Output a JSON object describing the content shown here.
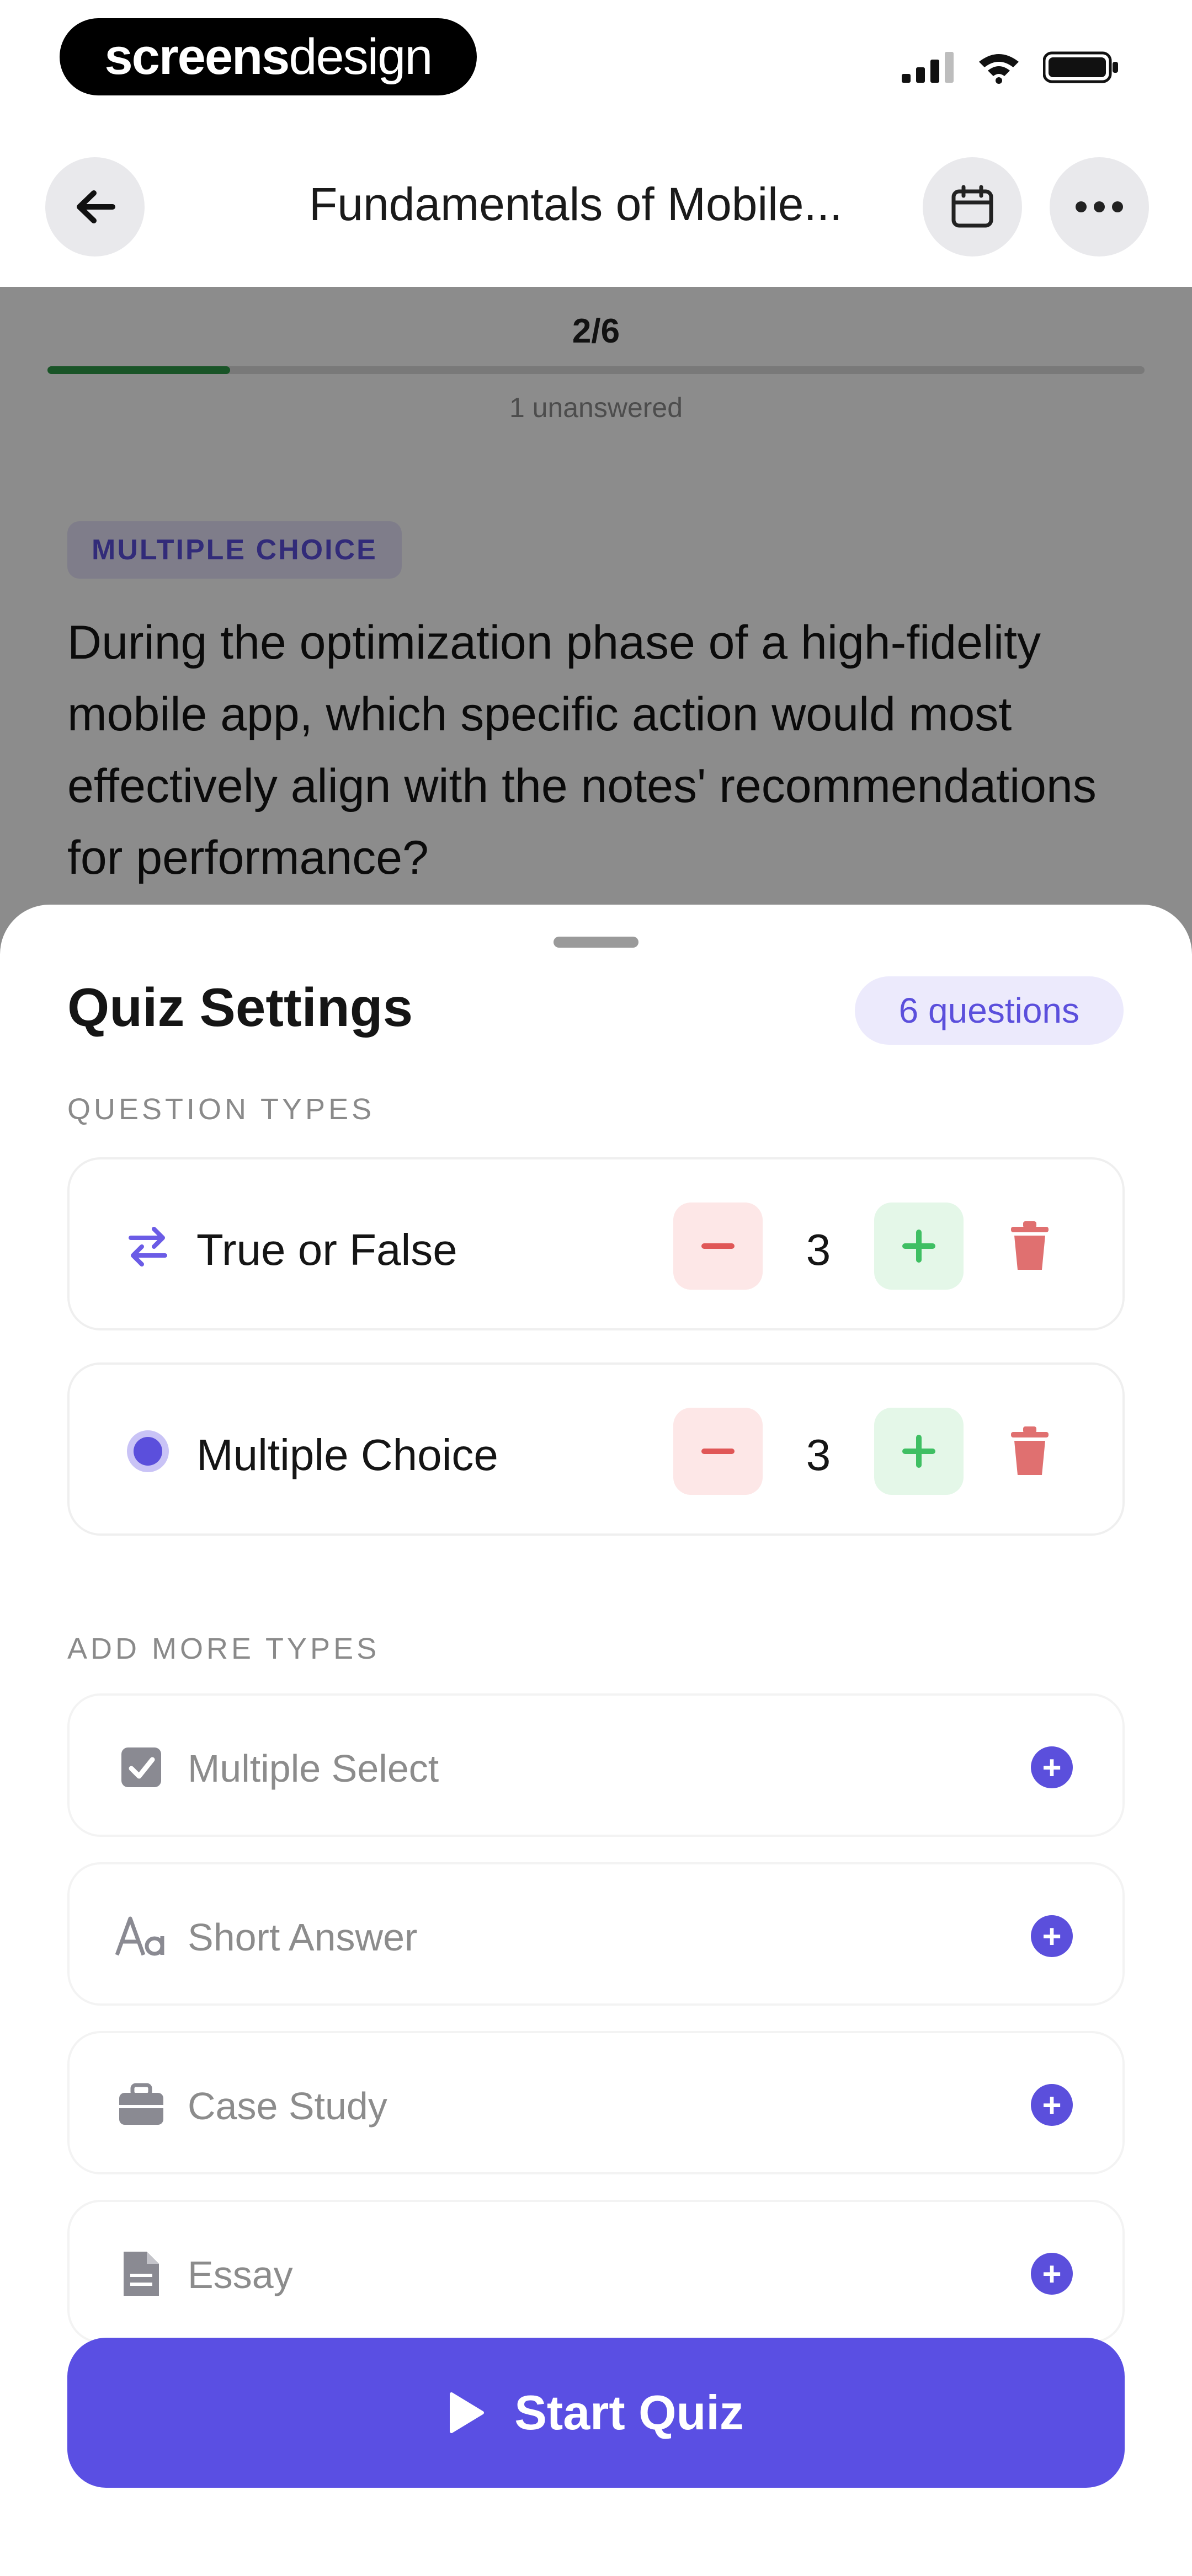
{
  "status_bar": {
    "watermark_bold": "screens",
    "watermark_light": "design"
  },
  "nav": {
    "title": "Fundamentals of Mobile..."
  },
  "quiz": {
    "progress_label": "2/6",
    "progress_fraction": 0.1667,
    "unanswered": "1 unanswered",
    "question_type_chip": "MULTIPLE CHOICE",
    "question_text": "During the optimization phase of a high-fidelity mobile app, which specific action would most effectively align with the notes' recommendations for performance?"
  },
  "sheet": {
    "title": "Quiz Settings",
    "question_count_badge": "6 questions",
    "question_types_label": "QUESTION TYPES",
    "question_types": [
      {
        "label": "True or False",
        "count": "3",
        "icon": "swap-arrows-icon"
      },
      {
        "label": "Multiple Choice",
        "count": "3",
        "icon": "radio-dot-icon"
      }
    ],
    "add_more_label": "ADD MORE TYPES",
    "add_types": [
      {
        "label": "Multiple Select",
        "icon": "checkbox-icon"
      },
      {
        "label": "Short Answer",
        "icon": "text-aa-icon"
      },
      {
        "label": "Case Study",
        "icon": "briefcase-icon"
      },
      {
        "label": "Essay",
        "icon": "document-icon"
      }
    ],
    "start_label": "Start Quiz"
  },
  "colors": {
    "accent": "#5a4fe3",
    "progress": "#2f9a48",
    "minus_bg": "#fde7e7",
    "plus_bg": "#e4f7e8",
    "trash": "#e07070"
  }
}
